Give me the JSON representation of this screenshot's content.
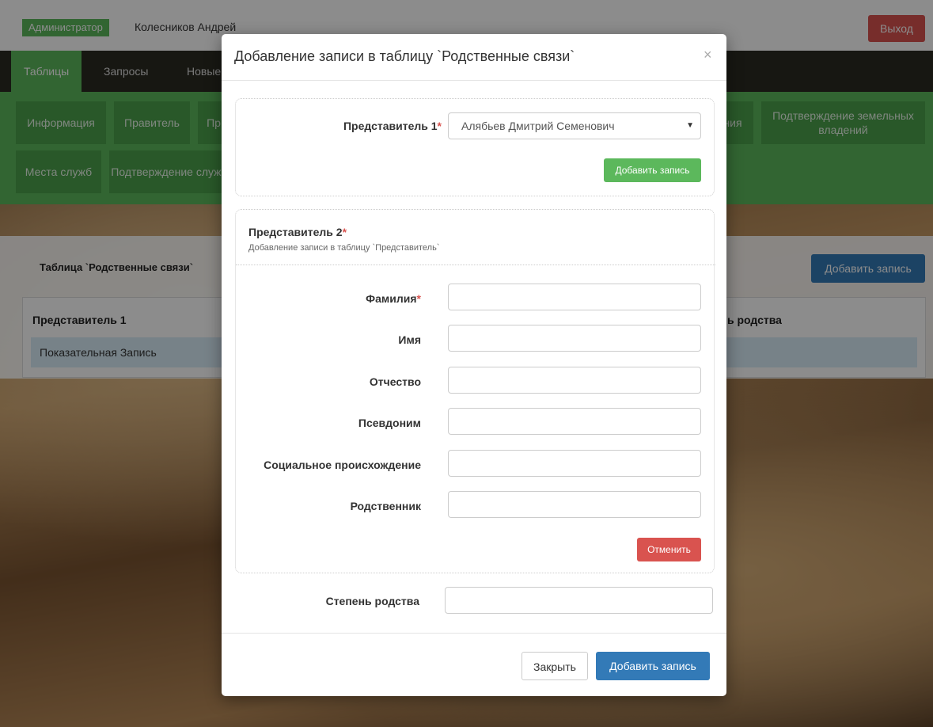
{
  "topbar": {
    "role": "Администратор",
    "user": "Колесников Андрей",
    "logout": "Выход"
  },
  "mainnav": {
    "tabs": [
      "Таблицы",
      "Запросы",
      "Новые"
    ]
  },
  "tablenav": {
    "items": [
      "Информация",
      "Правитель",
      "Пр",
      "ния",
      "Подтверждение земельных владений",
      "Места служб",
      "Подтверждение служб"
    ]
  },
  "content": {
    "panel_title": "Таблица `Родственные связи`",
    "add_button": "Добавить запись",
    "columns": [
      "Представитель 1",
      "ь родства"
    ],
    "row": "Показательная Запись"
  },
  "modal": {
    "title": "Добавление записи в таблицу `Родственные связи`",
    "close": "×",
    "rep1": {
      "label": "Представитель 1",
      "required": "*",
      "selected": "Алябьев Дмитрий Семенович",
      "caret": "▼",
      "add_button": "Добавить запись"
    },
    "rep2": {
      "title": "Представитель 2",
      "required": "*",
      "desc": "Добавление записи в таблицу `Представитель`",
      "fields": {
        "surname": "Фамилия",
        "name": "Имя",
        "patronymic": "Отчество",
        "pseudonym": "Псевдоним",
        "origin": "Социальное происхождение",
        "relative": "Родственник"
      },
      "cancel_button": "Отменить"
    },
    "kinship_label": "Степень родства",
    "footer": {
      "close": "Закрыть",
      "add": "Добавить запись"
    }
  }
}
